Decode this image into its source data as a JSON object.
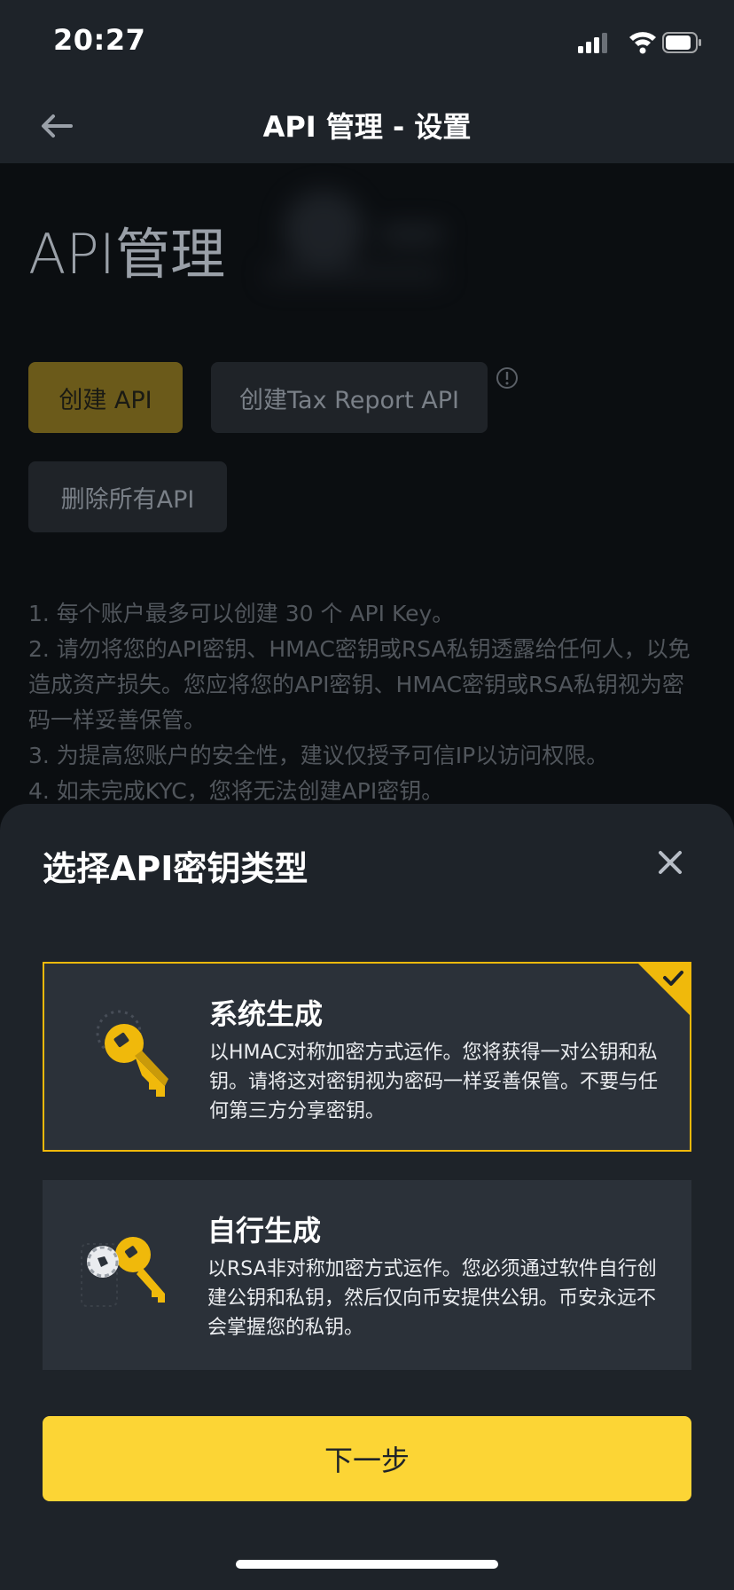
{
  "status_bar": {
    "time": "20:27"
  },
  "nav": {
    "title": "API 管理 - 设置"
  },
  "page": {
    "title": "API管理",
    "create_api": "创建 API",
    "create_tax_api": "创建Tax Report API",
    "delete_all": "删除所有API",
    "notes": [
      "1. 每个账户最多可以创建 30 个 API Key。",
      "2. 请勿将您的API密钥、HMAC密钥或RSA私钥透露给任何人，以免造成资产损失。您应将您的API密钥、HMAC密钥或RSA私钥视为密码一样妥善保管。",
      "3. 为提高您账户的安全性，建议仅授予可信IP以访问权限。",
      "4. 如未完成KYC，您将无法创建API密钥。"
    ]
  },
  "sheet": {
    "title": "选择API密钥类型",
    "options": [
      {
        "title": "系统生成",
        "desc": "以HMAC对称加密方式运作。您将获得一对公钥和私钥。请将这对密钥视为密码一样妥善保管。不要与任何第三方分享密钥。",
        "selected": true,
        "icon": "key-icon"
      },
      {
        "title": "自行生成",
        "desc": "以RSA非对称加密方式运作。您必须通过软件自行创建公钥和私钥，然后仅向币安提供公钥。币安永远不会掌握您的私钥。",
        "selected": false,
        "icon": "key-gear-icon"
      }
    ],
    "next": "下一步"
  },
  "colors": {
    "accent": "#fcd535",
    "selected_border": "#f0b90b",
    "sheet_bg": "#1e2329",
    "card_bg": "#2b3139"
  }
}
